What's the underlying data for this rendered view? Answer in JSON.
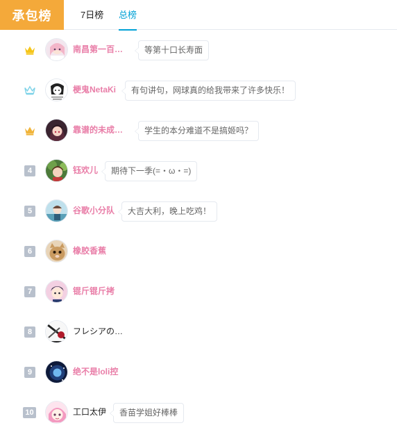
{
  "header": {
    "title": "承包榜",
    "tabs": [
      "7日榜",
      "总榜"
    ],
    "active_tab": "总榜"
  },
  "colors": {
    "accent_orange": "#f4a93a",
    "tab_active": "#00a1d6",
    "name_pink": "#e97ea8",
    "crown_gold": "#f5c518",
    "crown_silver": "#7fd3e8",
    "crown_bronze": "#f0b43a",
    "rank_badge": "#b8c0cc"
  },
  "ranking": [
    {
      "rank": "1",
      "rank_icon": "gold-crown-icon",
      "name": "南昌第一百…",
      "message": "等第十口长寿面"
    },
    {
      "rank": "2",
      "rank_icon": "silver-crown-icon",
      "name": "梗鬼NetaKi",
      "message": "有句讲句，网球真的给我带来了许多快乐！"
    },
    {
      "rank": "3",
      "rank_icon": "bronze-crown-icon",
      "name": "靠谱的未成…",
      "message": "学生的本分难道不是搞姬吗？"
    },
    {
      "rank": "4",
      "name": "钰欢儿",
      "message": "期待下一季(=・ω・=)"
    },
    {
      "rank": "5",
      "name": "谷歌小分队",
      "message": "大吉大利，晚上吃鸡！"
    },
    {
      "rank": "6",
      "name": "橡胶香蕉",
      "message": ""
    },
    {
      "rank": "7",
      "name": "锟斤锟斤拷",
      "message": ""
    },
    {
      "rank": "8",
      "name": "フレシアの…",
      "message": ""
    },
    {
      "rank": "9",
      "name": "绝不是loli控",
      "message": ""
    },
    {
      "rank": "10",
      "name": "工口太伊",
      "message": "香苗学姐好棒棒"
    }
  ]
}
